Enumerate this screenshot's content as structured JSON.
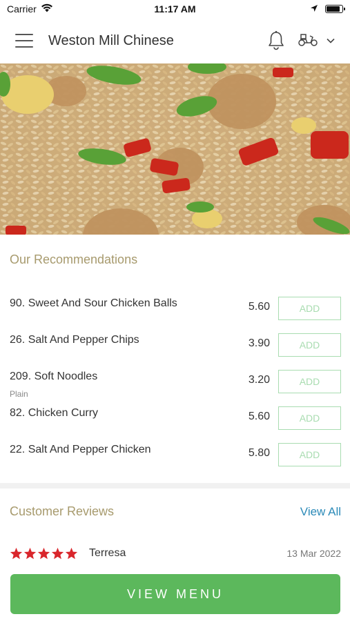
{
  "status_bar": {
    "carrier": "Carrier",
    "time": "11:17 AM"
  },
  "header": {
    "title": "Weston Mill Chinese",
    "notification_icon": "bell-icon",
    "delivery_icon": "scooter-icon",
    "dropdown_icon": "chevron-down-icon"
  },
  "hero": {
    "image": "fried-rice-photo"
  },
  "recommendations": {
    "title": "Our Recommendations",
    "items": [
      {
        "name": "90. Sweet And Sour Chicken Balls",
        "subtitle": "",
        "price": "5.60",
        "add_label": "ADD"
      },
      {
        "name": "26. Salt And Pepper Chips",
        "subtitle": "",
        "price": "3.90",
        "add_label": "ADD"
      },
      {
        "name": "209. Soft Noodles",
        "subtitle": "Plain",
        "price": "3.20",
        "add_label": "ADD"
      },
      {
        "name": "82. Chicken Curry",
        "subtitle": "",
        "price": "5.60",
        "add_label": "ADD"
      },
      {
        "name": "22. Salt And Pepper Chicken",
        "subtitle": "",
        "price": "5.80",
        "add_label": "ADD"
      }
    ]
  },
  "reviews": {
    "title": "Customer Reviews",
    "view_all_label": "View All",
    "latest": {
      "rating": 5,
      "reviewer": "Terresa",
      "date": "13 Mar 2022"
    }
  },
  "cta": {
    "label": "VIEW MENU"
  },
  "colors": {
    "accent_green": "#5cb85c",
    "add_border": "#a8dcb0",
    "section_title": "#a79a6d",
    "link_blue": "#2b8ab8",
    "star_red": "#d9262c"
  }
}
